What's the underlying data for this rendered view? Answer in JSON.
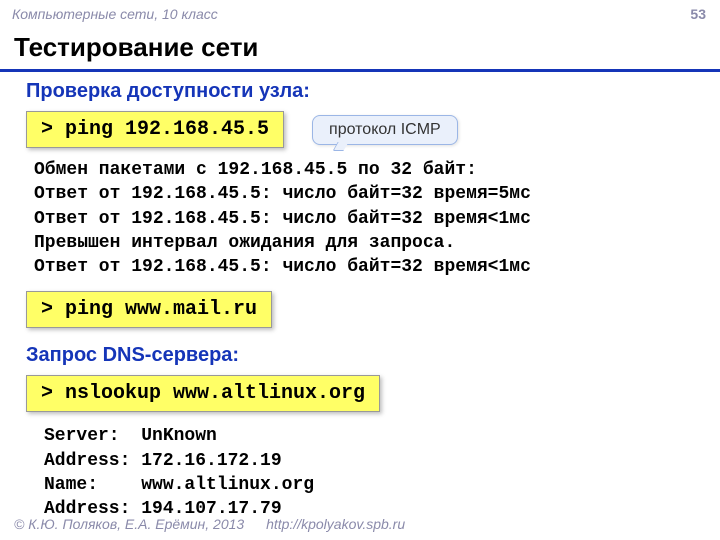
{
  "header": {
    "course": "Компьютерные сети, 10 класс",
    "page_number": "53"
  },
  "title": "Тестирование сети",
  "section1": {
    "heading": "Проверка доступности узла:",
    "cmd1": "> ping 192.168.45.5",
    "callout": "протокол ICMP",
    "output": "Обмен пакетами с 192.168.45.5 по 32 байт:\nОтвет от 192.168.45.5: число байт=32 время=5мс\nОтвет от 192.168.45.5: число байт=32 время<1мс\nПревышен интервал ожидания для запроса.\nОтвет от 192.168.45.5: число байт=32 время<1мс",
    "cmd2": "> ping www.mail.ru"
  },
  "section2": {
    "heading": "Запрос DNS-сервера:",
    "cmd": "> nslookup www.altlinux.org",
    "output": "Server:  UnKnown\nAddress: 172.16.172.19\nName:    www.altlinux.org\nAddress: 194.107.17.79"
  },
  "footer": {
    "copyright": "© К.Ю. Поляков, Е.А. Ерёмин, 2013",
    "url": "http://kpolyakov.spb.ru"
  }
}
